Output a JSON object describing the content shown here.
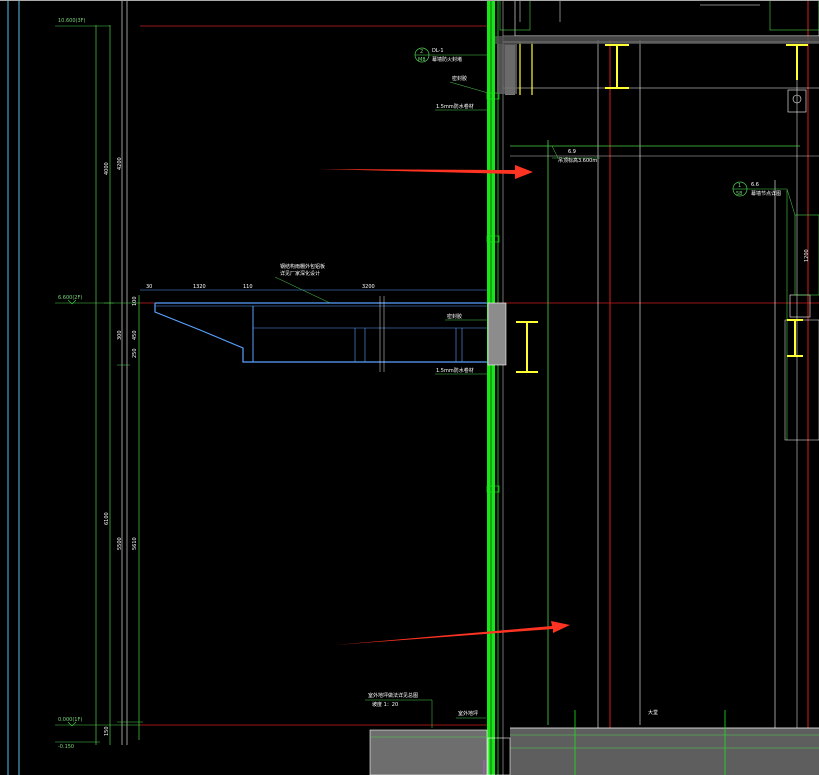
{
  "levels": {
    "top": "10.600(3F)",
    "mid": "6.600(2F)",
    "bottom": "0.000(1F)",
    "below": "-0.150"
  },
  "dimensions": {
    "vertical": [
      "4000",
      "4200",
      "6100",
      "5500",
      "5610",
      "300",
      "450",
      "100",
      "250",
      "150"
    ],
    "canopy": [
      "30",
      "1320",
      "110",
      "3200"
    ]
  },
  "annotations": {
    "ref_a_num": "2",
    "ref_a_sheet": "M8",
    "ref_a_text1": "DL-1",
    "ref_a_text2": "幕墙防火封堵",
    "label_sealant": "密封胶",
    "label_membrane": "1.5mm防水卷材",
    "label_ceiling_code": "6.9",
    "label_ceiling": "吊顶标高3.600m",
    "ref_b_num": "1",
    "ref_b_sheet": "58",
    "ref_b_text1": "6.6",
    "ref_b_text2": "幕墙节点详图",
    "label_canopy1": "钢结构雨棚外包铝板",
    "label_canopy2": "详见厂家深化设计",
    "label_sealant2": "密封胶",
    "label_membrane2": "1.5mm防水卷材",
    "label_ground1": "室外地坪做法详见总图",
    "label_ground2": "坡度 1：20",
    "label_ground3": "室外地坪",
    "label_hall": "大堂",
    "vertical_dim_mid": "1200"
  },
  "colors": {
    "background": "#000000",
    "curtain_wall": "#19e619",
    "arrow": "#ff3322",
    "steel": "#ffff33",
    "canopy": "#5aa0ff"
  }
}
